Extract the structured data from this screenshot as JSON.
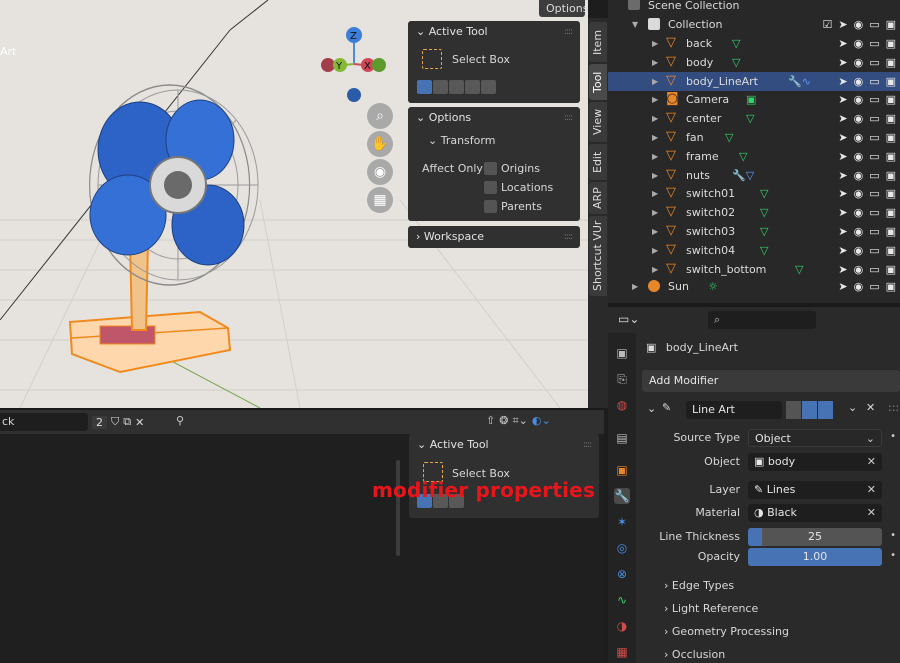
{
  "viewport": {
    "object_label": "Art",
    "options_label": "Options",
    "gizmo": {
      "z": "Z",
      "y": "Y",
      "x": "X"
    }
  },
  "npanel": {
    "active_tool": {
      "title": "Active Tool",
      "tool": "Select Box"
    },
    "options": {
      "title": "Options",
      "transform": "Transform",
      "affect_only": "Affect Only",
      "checks": [
        "Origins",
        "Locations",
        "Parents"
      ]
    },
    "workspace": "Workspace",
    "tabs": [
      "Item",
      "Tool",
      "View",
      "Edit",
      "ARP",
      "Shortcut VUr"
    ]
  },
  "outliner": {
    "scene_collection": "Scene Collection",
    "collection": "Collection",
    "items": [
      {
        "name": "back",
        "selected": false
      },
      {
        "name": "body",
        "selected": false
      },
      {
        "name": "body_LineArt",
        "selected": true
      },
      {
        "name": "Camera",
        "selected": false
      },
      {
        "name": "center",
        "selected": false
      },
      {
        "name": "fan",
        "selected": false
      },
      {
        "name": "frame",
        "selected": false
      },
      {
        "name": "nuts",
        "selected": false
      },
      {
        "name": "switch01",
        "selected": false
      },
      {
        "name": "switch02",
        "selected": false
      },
      {
        "name": "switch03",
        "selected": false
      },
      {
        "name": "switch04",
        "selected": false
      },
      {
        "name": "switch_bottom",
        "selected": false
      }
    ],
    "sun": "Sun"
  },
  "properties": {
    "object_name": "body_LineArt",
    "add_modifier": "Add Modifier",
    "modifier_name": "Line Art",
    "fields": {
      "source_type_label": "Source Type",
      "source_type_value": "Object",
      "object_label": "Object",
      "object_value": "body",
      "layer_label": "Layer",
      "layer_value": "Lines",
      "material_label": "Material",
      "material_value": "Black",
      "thickness_label": "Line Thickness",
      "thickness_value": "25",
      "opacity_label": "Opacity",
      "opacity_value": "1.00"
    },
    "subpanels": [
      "Edge Types",
      "Light Reference",
      "Geometry Processing",
      "Occlusion"
    ]
  },
  "bottom_editor": {
    "field_text": "ck",
    "user_count": "2",
    "active_tool": {
      "title": "Active Tool",
      "tool": "Select Box"
    }
  },
  "annotation": "modifier properties",
  "colors": {
    "selection": "#334d80",
    "accent": "#4772b3",
    "annotation": "#e8151b",
    "mesh_icon": "#e8862a",
    "modifier_green": "#33d46c"
  }
}
